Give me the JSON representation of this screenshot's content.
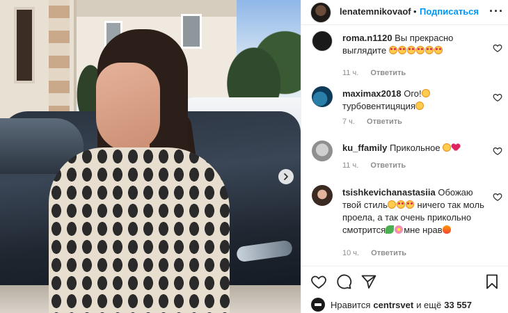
{
  "post": {
    "username": "lenatemnikovaof",
    "separator": "•",
    "follow_label": "Подписаться",
    "more_label": "···"
  },
  "comments": [
    {
      "username": "roma.n1120",
      "text": "Вы прекрасно выглядите",
      "emojis": [
        "heart-eyes",
        "heart-eyes",
        "heart-eyes",
        "heart-eyes",
        "heart-eyes",
        "heart-eyes"
      ],
      "time": "11 ч.",
      "reply_label": "Ответить",
      "avatar_icon": "black-logo-avatar"
    },
    {
      "username": "maximax2018",
      "text": "Ого!",
      "text2": "турбовентицяция",
      "time": "7 ч.",
      "reply_label": "Ответить",
      "avatar_icon": "sea-photo-avatar"
    },
    {
      "username": "ku_ffamily",
      "text": "Прикольное",
      "time": "11 ч.",
      "reply_label": "Ответить",
      "avatar_icon": "grey-photo-avatar"
    },
    {
      "username": "tsishkevichanastasiia",
      "text": "Обожаю твой стиль",
      "text2": "ничего так моль проела, а так очень прикольно смотрится",
      "text3": "мне нрав",
      "time": "10 ч.",
      "reply_label": "Ответить",
      "avatar_icon": "woman-photo-avatar"
    }
  ],
  "likes": {
    "prefix": "Нравится",
    "user": "centrsvet",
    "middle": "и ещё",
    "count": "33 557"
  },
  "icons": {
    "like": "heart-outline-icon",
    "comment": "comment-bubble-icon",
    "share": "paper-plane-icon",
    "save": "bookmark-icon",
    "next": "chevron-right-icon"
  },
  "colors": {
    "accent": "#0095f6",
    "meta": "#8e8e8e",
    "text": "#262626"
  }
}
